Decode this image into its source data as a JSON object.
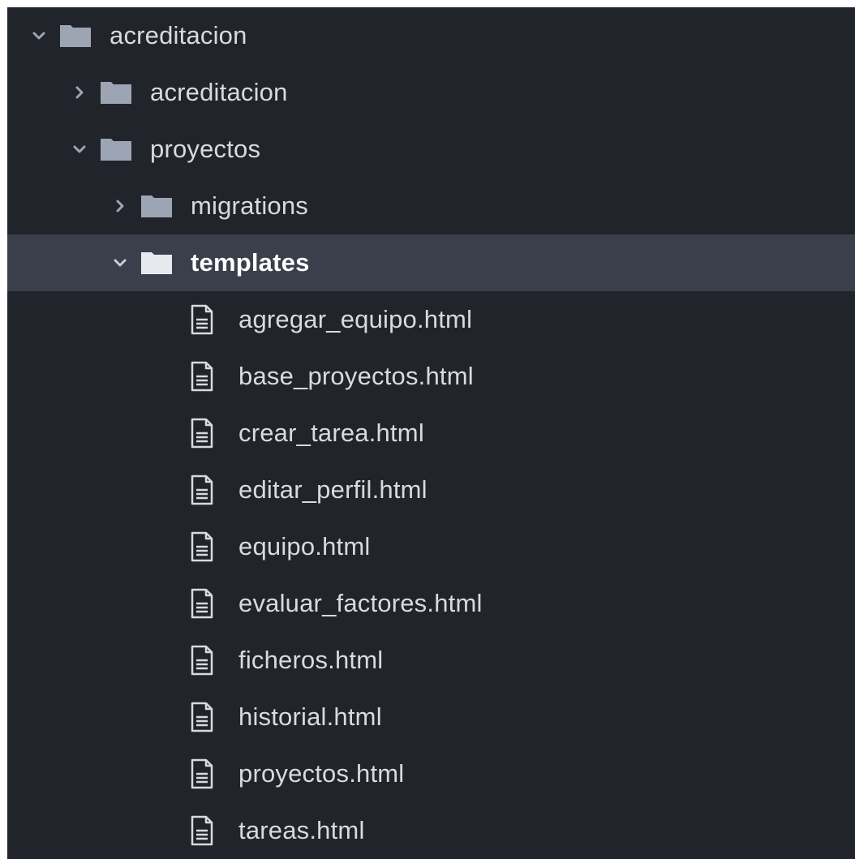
{
  "tree": {
    "root": {
      "label": "acreditacion",
      "expanded": true,
      "icon": "chevron-down-icon",
      "folder_icon": "folder-icon"
    },
    "child_acreditacion": {
      "label": "acreditacion",
      "expanded": false,
      "icon": "chevron-right-icon"
    },
    "child_proyectos": {
      "label": "proyectos",
      "expanded": true,
      "icon": "chevron-down-icon"
    },
    "migrations": {
      "label": "migrations",
      "expanded": false,
      "icon": "chevron-right-icon"
    },
    "templates": {
      "label": "templates",
      "expanded": true,
      "selected": true,
      "icon": "chevron-down-icon"
    },
    "files": [
      {
        "label": "agregar_equipo.html",
        "icon": "file-text-icon"
      },
      {
        "label": "base_proyectos.html",
        "icon": "file-text-icon"
      },
      {
        "label": "crear_tarea.html",
        "icon": "file-text-icon"
      },
      {
        "label": "editar_perfil.html",
        "icon": "file-text-icon"
      },
      {
        "label": "equipo.html",
        "icon": "file-text-icon"
      },
      {
        "label": "evaluar_factores.html",
        "icon": "file-text-icon"
      },
      {
        "label": "ficheros.html",
        "icon": "file-text-icon"
      },
      {
        "label": "historial.html",
        "icon": "file-text-icon"
      },
      {
        "label": "proyectos.html",
        "icon": "file-text-icon"
      },
      {
        "label": "tareas.html",
        "icon": "file-text-icon"
      }
    ]
  },
  "colors": {
    "panel_background": "#21252b",
    "selected_row_background": "#3a3f4b",
    "text": "#d7dae0",
    "selected_text": "#ffffff",
    "folder_fill": "#9da5b4",
    "selected_folder_fill": "#e6e9ee",
    "arrow": "#9da5b4"
  }
}
